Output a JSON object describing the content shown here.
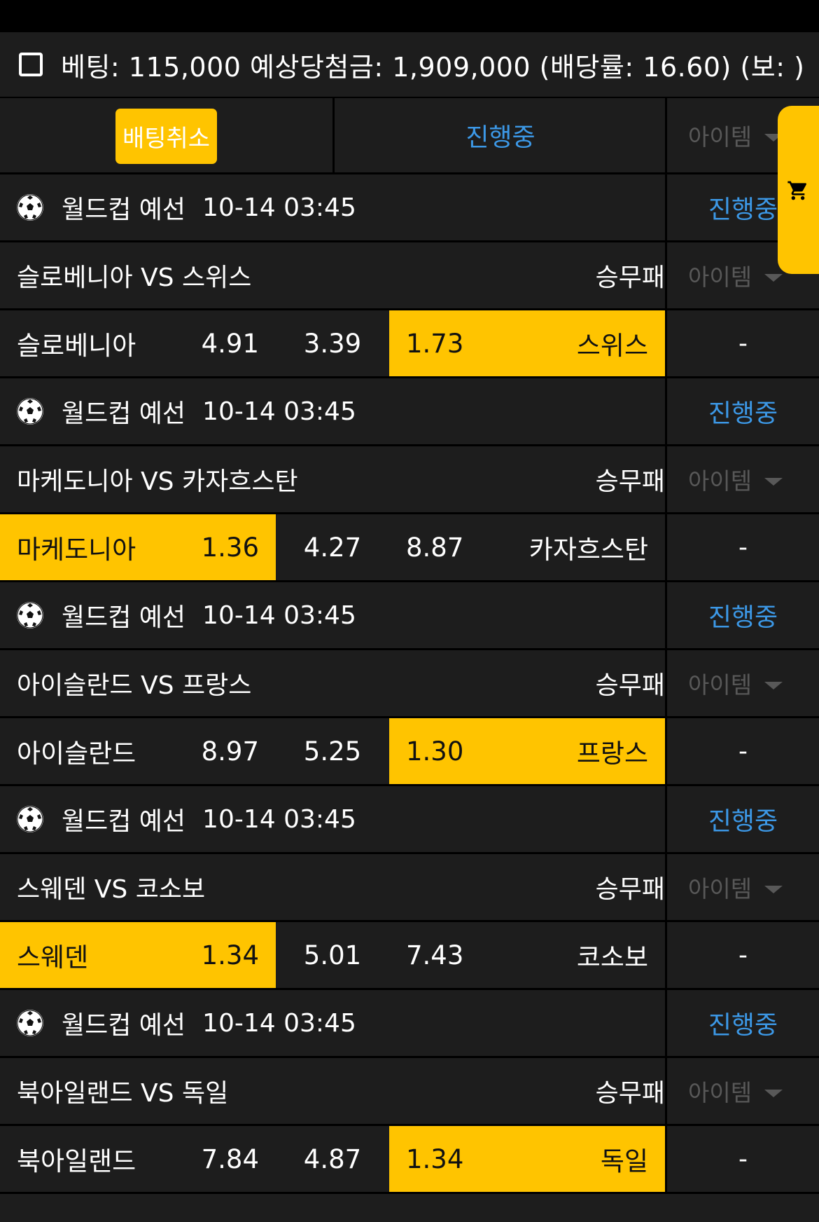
{
  "summary": {
    "text": "베팅: 115,000 예상당첨금: 1,909,000 (배당률: 16.60) (보: )"
  },
  "actions": {
    "cancel_label": "배팅취소",
    "status_tab": "진행중",
    "item_label": "아이템"
  },
  "icons": {
    "ball": "soccer-ball-icon",
    "cart": "cart-icon",
    "caret": "caret-down-icon"
  },
  "colors": {
    "accent": "#ffc400",
    "live": "#3c98e6",
    "bg": "#1d1d1d"
  },
  "matches": [
    {
      "league": "월드컵 예선",
      "time": "10-14 03:45",
      "status": "진행중",
      "title": "슬로베니아 VS 스위스",
      "market": "승무패",
      "item": "아이템",
      "home": "슬로베니아",
      "home_odds": "4.91",
      "draw_odds": "3.39",
      "away_odds": "1.73",
      "away": "스위스",
      "selected": "away",
      "result": "-"
    },
    {
      "league": "월드컵 예선",
      "time": "10-14 03:45",
      "status": "진행중",
      "title": "마케도니아 VS 카자흐스탄",
      "market": "승무패",
      "item": "아이템",
      "home": "마케도니아",
      "home_odds": "1.36",
      "draw_odds": "4.27",
      "away_odds": "8.87",
      "away": "카자흐스탄",
      "selected": "home",
      "result": "-"
    },
    {
      "league": "월드컵 예선",
      "time": "10-14 03:45",
      "status": "진행중",
      "title": "아이슬란드 VS 프랑스",
      "market": "승무패",
      "item": "아이템",
      "home": "아이슬란드",
      "home_odds": "8.97",
      "draw_odds": "5.25",
      "away_odds": "1.30",
      "away": "프랑스",
      "selected": "away",
      "result": "-"
    },
    {
      "league": "월드컵 예선",
      "time": "10-14 03:45",
      "status": "진행중",
      "title": "스웨덴 VS 코소보",
      "market": "승무패",
      "item": "아이템",
      "home": "스웨덴",
      "home_odds": "1.34",
      "draw_odds": "5.01",
      "away_odds": "7.43",
      "away": "코소보",
      "selected": "home",
      "result": "-"
    },
    {
      "league": "월드컵 예선",
      "time": "10-14 03:45",
      "status": "진행중",
      "title": "북아일랜드 VS 독일",
      "market": "승무패",
      "item": "아이템",
      "home": "북아일랜드",
      "home_odds": "7.84",
      "draw_odds": "4.87",
      "away_odds": "1.34",
      "away": "독일",
      "selected": "away",
      "result": "-"
    }
  ]
}
